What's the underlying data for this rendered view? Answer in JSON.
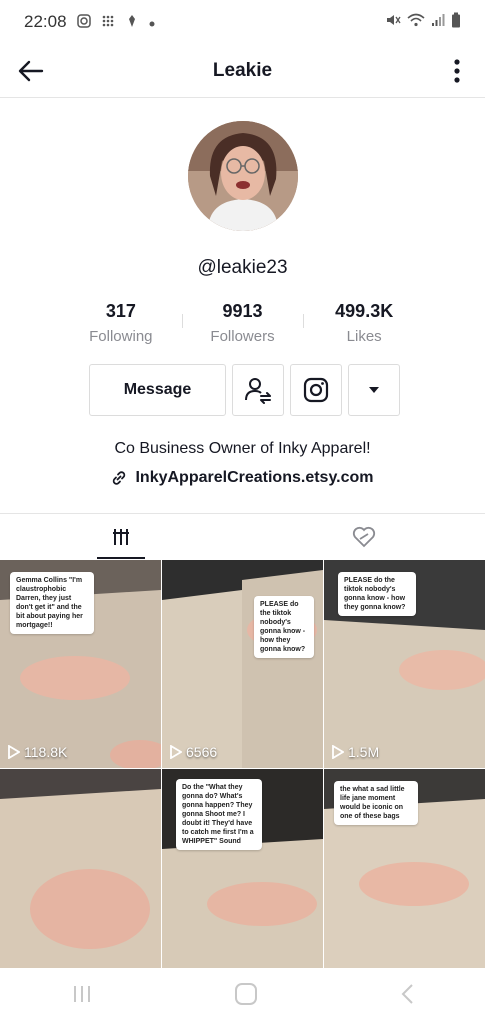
{
  "status_bar": {
    "time": "22:08"
  },
  "header": {
    "title": "Leakie"
  },
  "profile": {
    "username": "@leakie23",
    "stats": [
      {
        "value": "317",
        "label": "Following"
      },
      {
        "value": "9913",
        "label": "Followers"
      },
      {
        "value": "499.3K",
        "label": "Likes"
      }
    ],
    "message_label": "Message",
    "bio": "Co Business Owner of Inky Apparel!",
    "link": "InkyApparelCreations.etsy.com"
  },
  "videos": [
    {
      "views": "118.8K",
      "caption": "Gemma Collins \"I'm claustrophobic Darren, they just don't get it\" and the bit about paying her mortgage!!"
    },
    {
      "views": "6566",
      "caption": "PLEASE do the tiktok nobody's gonna know - how they gonna know?"
    },
    {
      "views": "1.5M",
      "caption": "PLEASE do the tiktok nobody's gonna know - how they gonna know?"
    },
    {
      "views": "",
      "caption": ""
    },
    {
      "views": "",
      "caption": "Do the \"What they gonna do? What's gonna happen? They gonna Shoot me? I doubt it! They'd have to catch me first I'm a WHIPPET\" Sound"
    },
    {
      "views": "",
      "caption": "the what a sad little life jane moment would be iconic on one of these bags"
    }
  ],
  "colors": {
    "text": "#161823",
    "secondary": "#8a8b91"
  }
}
